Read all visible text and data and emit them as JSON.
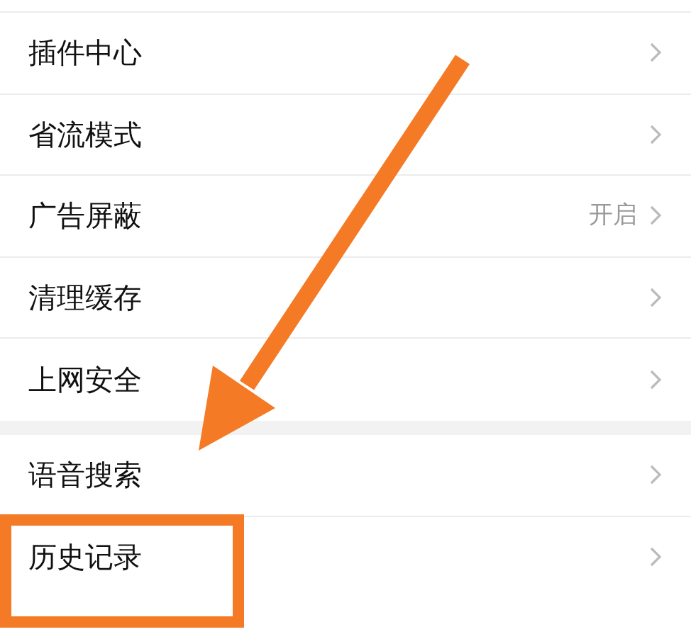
{
  "sections": [
    {
      "items": [
        {
          "label": "插件中心",
          "highlighted": false
        },
        {
          "label": "省流模式",
          "highlighted": false
        },
        {
          "label": "广告屏蔽",
          "value": "开启",
          "highlighted": false
        },
        {
          "label": "清理缓存",
          "highlighted": false
        },
        {
          "label": "上网安全",
          "highlighted": false
        }
      ]
    },
    {
      "items": [
        {
          "label": "语音搜索",
          "highlighted": false
        },
        {
          "label": "历史记录",
          "highlighted": true
        }
      ]
    }
  ],
  "pointer_arrow": true
}
